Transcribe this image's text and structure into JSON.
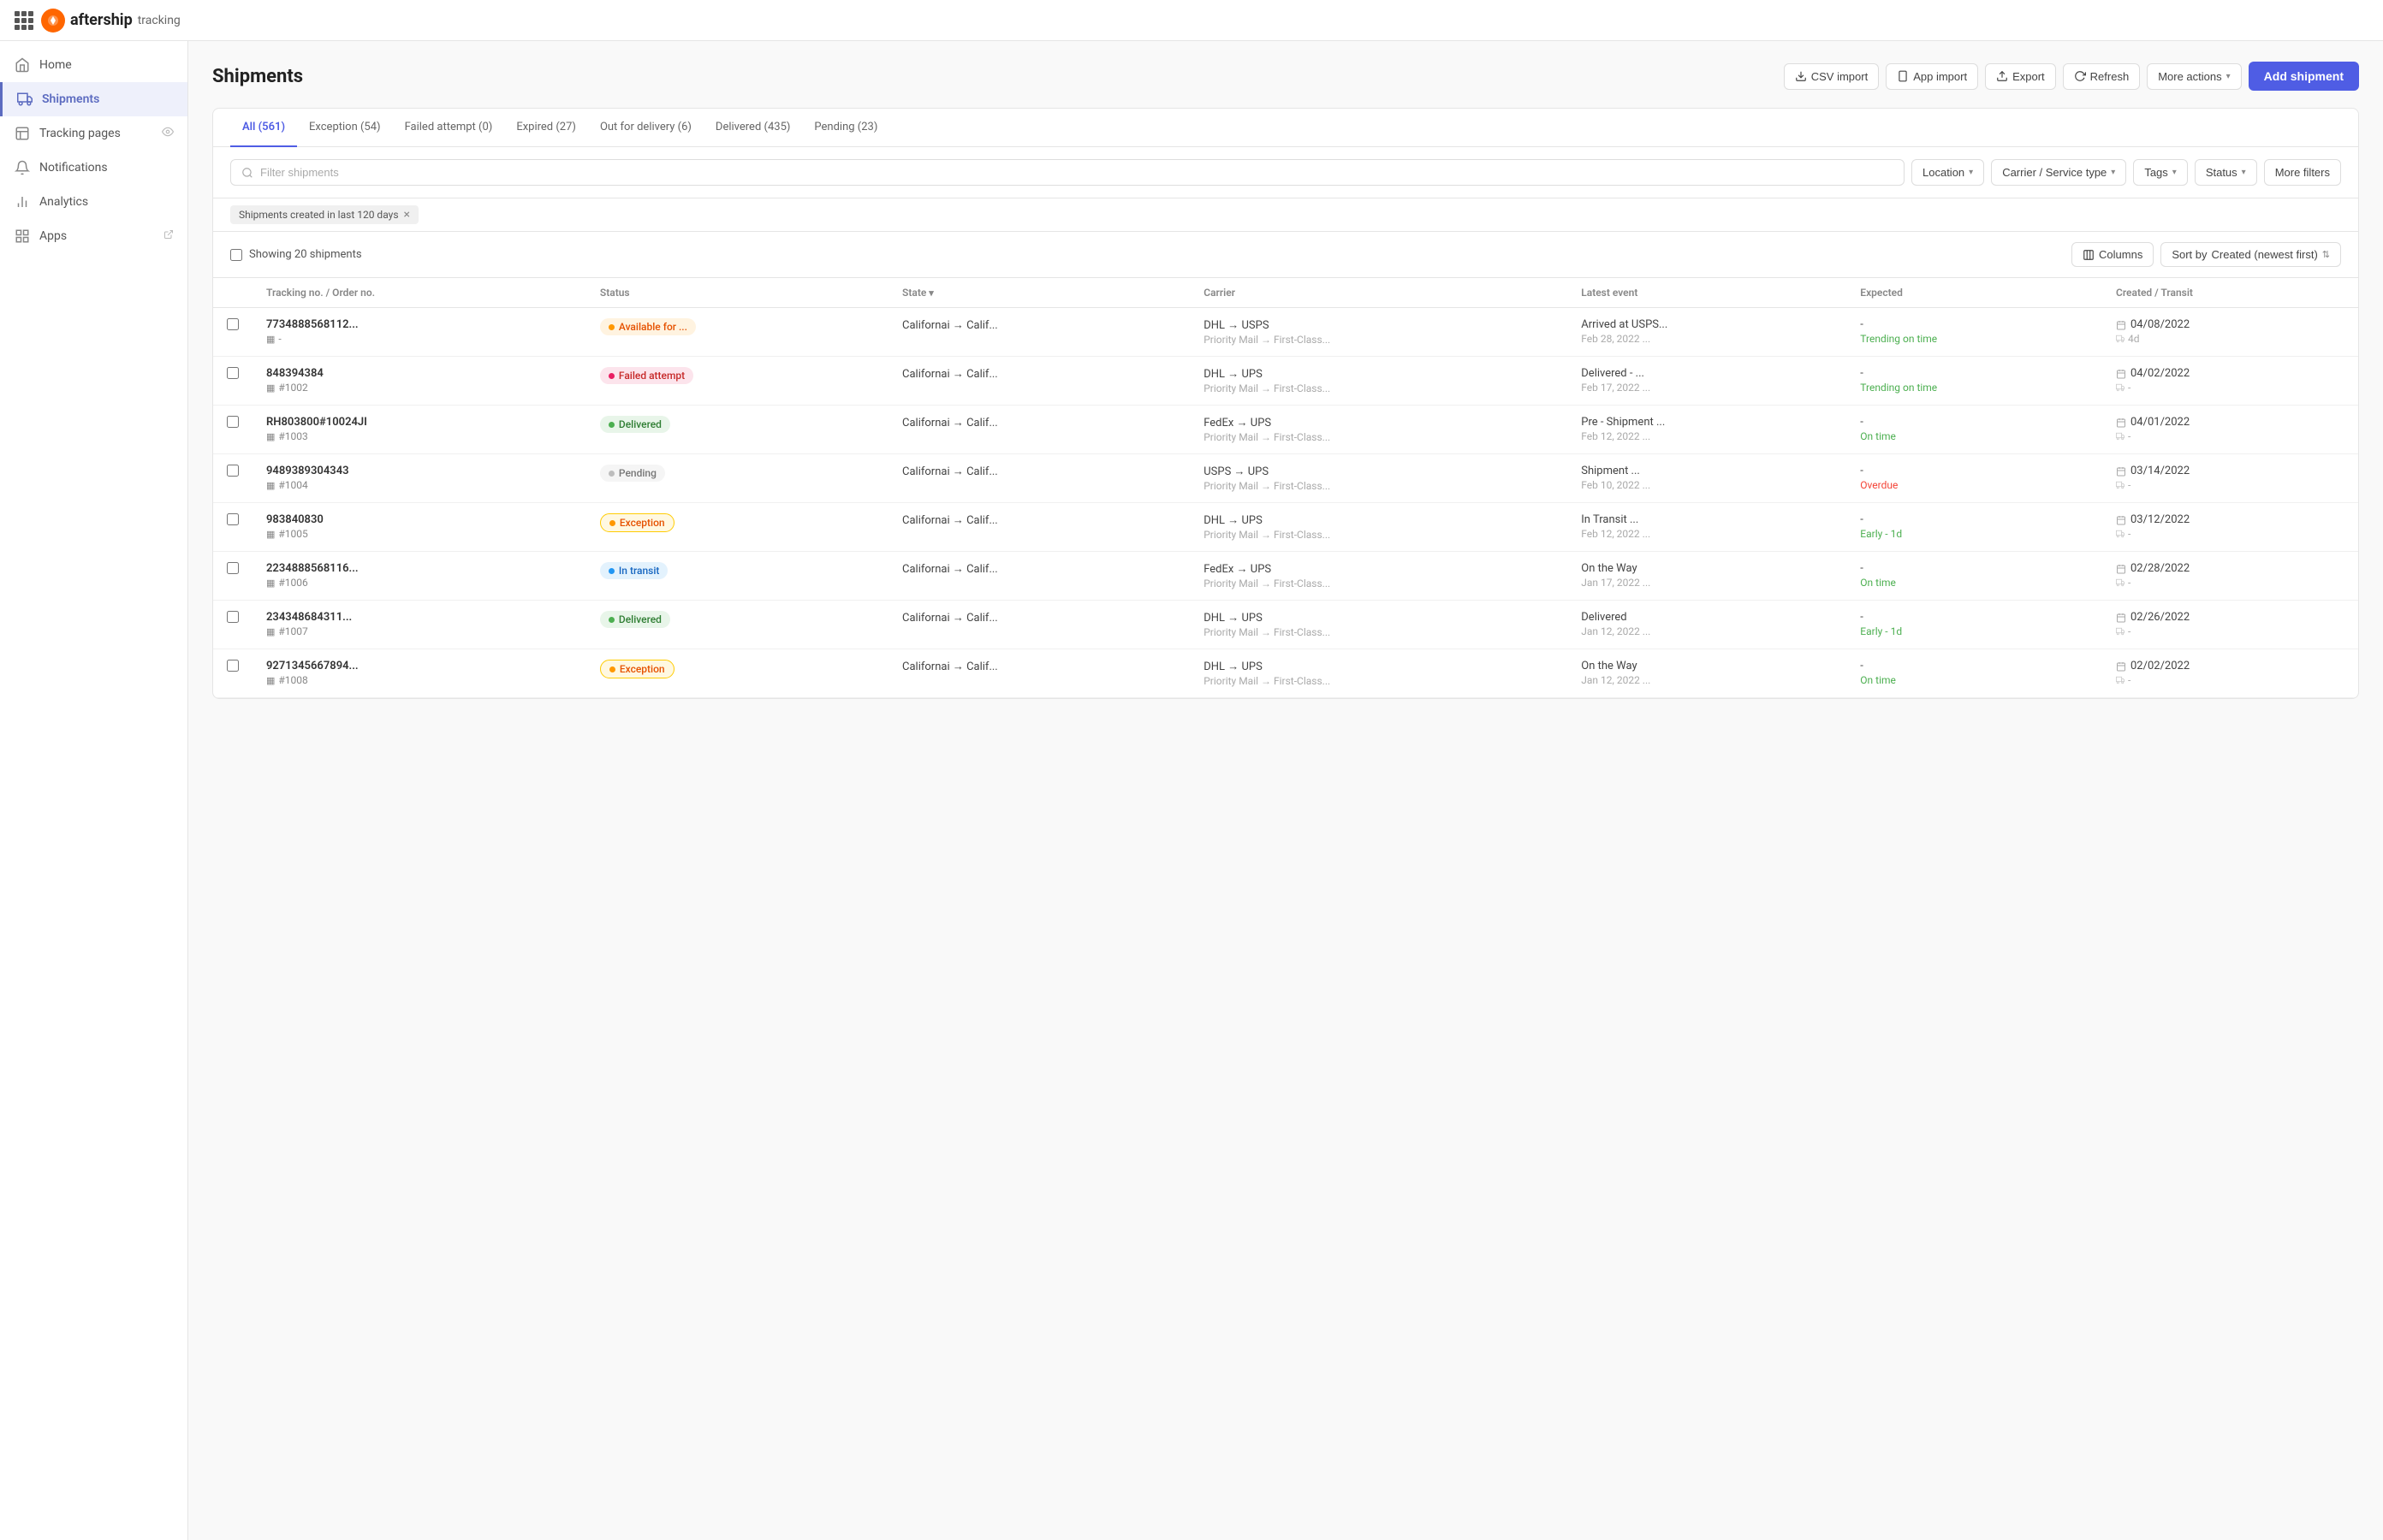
{
  "topbar": {
    "logo_text": "aftership",
    "logo_subtext": "tracking"
  },
  "sidebar": {
    "items": [
      {
        "id": "home",
        "label": "Home",
        "active": false
      },
      {
        "id": "shipments",
        "label": "Shipments",
        "active": true
      },
      {
        "id": "tracking-pages",
        "label": "Tracking pages",
        "active": false,
        "has_eye": true
      },
      {
        "id": "notifications",
        "label": "Notifications",
        "active": false
      },
      {
        "id": "analytics",
        "label": "Analytics",
        "active": false
      },
      {
        "id": "apps",
        "label": "Apps",
        "active": false,
        "has_external": true
      }
    ]
  },
  "page": {
    "title": "Shipments"
  },
  "header_actions": {
    "csv_import": "CSV import",
    "app_import": "App import",
    "export": "Export",
    "refresh": "Refresh",
    "more_actions": "More actions",
    "add_shipment": "Add shipment"
  },
  "tabs": [
    {
      "id": "all",
      "label": "All (561)",
      "active": true
    },
    {
      "id": "exception",
      "label": "Exception (54)",
      "active": false
    },
    {
      "id": "failed",
      "label": "Failed attempt (0)",
      "active": false
    },
    {
      "id": "expired",
      "label": "Expired (27)",
      "active": false
    },
    {
      "id": "out-delivery",
      "label": "Out for delivery (6)",
      "active": false
    },
    {
      "id": "delivered",
      "label": "Delivered (435)",
      "active": false
    },
    {
      "id": "pending",
      "label": "Pending (23)",
      "active": false
    }
  ],
  "filters": {
    "search_placeholder": "Filter shipments",
    "location": "Location",
    "carrier_service": "Carrier / Service type",
    "tags": "Tags",
    "status": "Status",
    "more_filters": "More filters"
  },
  "active_filter": {
    "label": "Shipments created in last 120 days"
  },
  "table_controls": {
    "showing": "Showing 20 shipments",
    "columns_btn": "Columns",
    "sort_label": "Sort by",
    "sort_value": "Created (newest first)"
  },
  "columns": [
    "Tracking no. / Order no.",
    "Status",
    "State",
    "Carrier",
    "Latest event",
    "Expected",
    "Created / Transit"
  ],
  "shipments": [
    {
      "tracking": "7734888568112...",
      "order": "-",
      "status_type": "available",
      "status_label": "Available for ...",
      "state": "Californai → Calif...",
      "carrier_main": "DHL → USPS",
      "carrier_sub": "Priority Mail → First-Class...",
      "event_main": "Arrived at USPS...",
      "event_date": "Feb 28, 2022 ...",
      "expected_main": "-",
      "expected_sub": "Trending on time",
      "expected_sub_type": "ontime",
      "created_date": "04/08/2022",
      "transit": "4d"
    },
    {
      "tracking": "848394384",
      "order": "#1002",
      "status_type": "failed",
      "status_label": "Failed attempt",
      "state": "Californai → Calif...",
      "carrier_main": "DHL → UPS",
      "carrier_sub": "Priority Mail → First-Class...",
      "event_main": "Delivered - ...",
      "event_date": "Feb 17, 2022 ...",
      "expected_main": "-",
      "expected_sub": "Trending on time",
      "expected_sub_type": "ontime",
      "created_date": "04/02/2022",
      "transit": "-"
    },
    {
      "tracking": "RH803800#10024JI",
      "order": "#1003",
      "status_type": "delivered",
      "status_label": "Delivered",
      "state": "Californai → Calif...",
      "carrier_main": "FedEx → UPS",
      "carrier_sub": "Priority Mail → First-Class...",
      "event_main": "Pre - Shipment ...",
      "event_date": "Feb 12, 2022 ...",
      "expected_main": "-",
      "expected_sub": "On time",
      "expected_sub_type": "ontime",
      "created_date": "04/01/2022",
      "transit": "-"
    },
    {
      "tracking": "9489389304343",
      "order": "#1004",
      "status_type": "pending",
      "status_label": "Pending",
      "state": "Californai → Calif...",
      "carrier_main": "USPS → UPS",
      "carrier_sub": "Priority Mail → First-Class...",
      "event_main": "Shipment ...",
      "event_date": "Feb 10, 2022 ...",
      "expected_main": "-",
      "expected_sub": "Overdue",
      "expected_sub_type": "overdue",
      "created_date": "03/14/2022",
      "transit": "-"
    },
    {
      "tracking": "983840830",
      "order": "#1005",
      "status_type": "exception",
      "status_label": "Exception",
      "state": "Californai → Calif...",
      "carrier_main": "DHL → UPS",
      "carrier_sub": "Priority Mail → First-Class...",
      "event_main": "In Transit ...",
      "event_date": "Feb 12, 2022 ...",
      "expected_main": "-",
      "expected_sub": "Early - 1d",
      "expected_sub_type": "early",
      "created_date": "03/12/2022",
      "transit": "-"
    },
    {
      "tracking": "2234888568116...",
      "order": "#1006",
      "status_type": "intransit",
      "status_label": "In transit",
      "state": "Californai → Calif...",
      "carrier_main": "FedEx → UPS",
      "carrier_sub": "Priority Mail → First-Class...",
      "event_main": "On the Way",
      "event_date": "Jan 17, 2022 ...",
      "expected_main": "-",
      "expected_sub": "On time",
      "expected_sub_type": "ontime",
      "created_date": "02/28/2022",
      "transit": "-"
    },
    {
      "tracking": "234348684311...",
      "order": "#1007",
      "status_type": "delivered",
      "status_label": "Delivered",
      "state": "Californai → Calif...",
      "carrier_main": "DHL → UPS",
      "carrier_sub": "Priority Mail → First-Class...",
      "event_main": "Delivered",
      "event_date": "Jan 12, 2022 ...",
      "expected_main": "-",
      "expected_sub": "Early - 1d",
      "expected_sub_type": "early",
      "created_date": "02/26/2022",
      "transit": "-"
    },
    {
      "tracking": "9271345667894...",
      "order": "#1008",
      "status_type": "exception",
      "status_label": "Exception",
      "state": "Californai → Calif...",
      "carrier_main": "DHL → UPS",
      "carrier_sub": "Priority Mail → First-Class...",
      "event_main": "On the Way",
      "event_date": "Jan 12, 2022 ...",
      "expected_main": "-",
      "expected_sub": "On time",
      "expected_sub_type": "ontime",
      "created_date": "02/02/2022",
      "transit": "-"
    }
  ]
}
